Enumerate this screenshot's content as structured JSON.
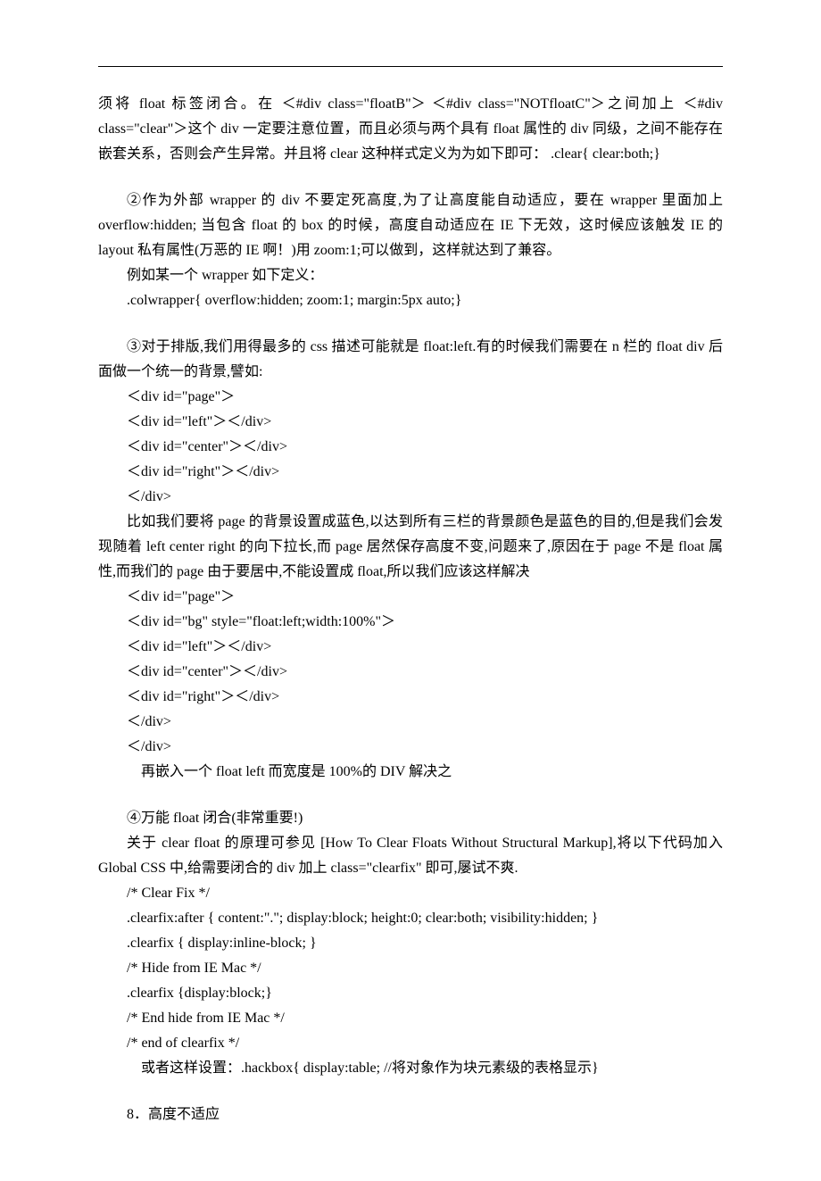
{
  "p1": "须将 float 标签闭合。在 ＜#div class=\"floatB\"＞ ＜#div class=\"NOTfloatC\"＞之间加上 ＜#div class=\"clear\"＞这个 div 一定要注意位置，而且必须与两个具有 float 属性的 div 同级，之间不能存在嵌套关系，否则会产生异常。并且将 clear 这种样式定义为为如下即可：  .clear{ clear:both;}",
  "p2": "②作为外部 wrapper 的 div 不要定死高度,为了让高度能自动适应，要在 wrapper 里面加上 overflow:hidden; 当包含 float 的 box 的时候，高度自动适应在 IE 下无效，这时候应该触发 IE 的 layout 私有属性(万恶的 IE 啊！)用 zoom:1;可以做到，这样就达到了兼容。",
  "p2a": "例如某一个 wrapper 如下定义：",
  "p2b": ".colwrapper{ overflow:hidden; zoom:1; margin:5px auto;}",
  "p3": "③对于排版,我们用得最多的 css 描述可能就是 float:left.有的时候我们需要在 n 栏的 float div 后面做一个统一的背景,譬如:",
  "c1_1": "＜div id=\"page\"＞",
  "c1_2": "＜div id=\"left\"＞＜/div>",
  "c1_3": "＜div id=\"center\"＞＜/div>",
  "c1_4": "＜div id=\"right\"＞＜/div>",
  "c1_5": "＜/div>",
  "p4": "比如我们要将 page 的背景设置成蓝色,以达到所有三栏的背景颜色是蓝色的目的,但是我们会发现随着 left center right 的向下拉长,而 page 居然保存高度不变,问题来了,原因在于 page 不是 float 属性,而我们的 page 由于要居中,不能设置成 float,所以我们应该这样解决",
  "c2_1": "＜div id=\"page\"＞",
  "c2_2": "＜div id=\"bg\"  style=\"float:left;width:100%\"＞",
  "c2_3": "＜div id=\"left\"＞＜/div>",
  "c2_4": "＜div id=\"center\"＞＜/div>",
  "c2_5": "＜div id=\"right\"＞＜/div>",
  "c2_6": "＜/div>",
  "c2_7": "＜/div>",
  "p5": "再嵌入一个 float left 而宽度是 100%的 DIV 解决之",
  "p6": "④万能 float 闭合(非常重要!)",
  "p7": "关于 clear float 的原理可参见 [How To Clear Floats Without Structural Markup],将以下代码加入 Global CSS 中,给需要闭合的 div 加上 class=\"clearfix\" 即可,屡试不爽.",
  "cf1": "/* Clear Fix */",
  "cf2": ".clearfix:after { content:\".\"; display:block; height:0; clear:both; visibility:hidden; }",
  "cf3": ".clearfix { display:inline-block; }",
  "cf4": "/* Hide from IE Mac */",
  "cf5": ".clearfix {display:block;}",
  "cf6": "/* End hide from IE Mac */",
  "cf7": "/* end of clearfix */",
  "p8": "或者这样设置：.hackbox{ display:table; //将对象作为块元素级的表格显示}",
  "p9": "8．高度不适应"
}
